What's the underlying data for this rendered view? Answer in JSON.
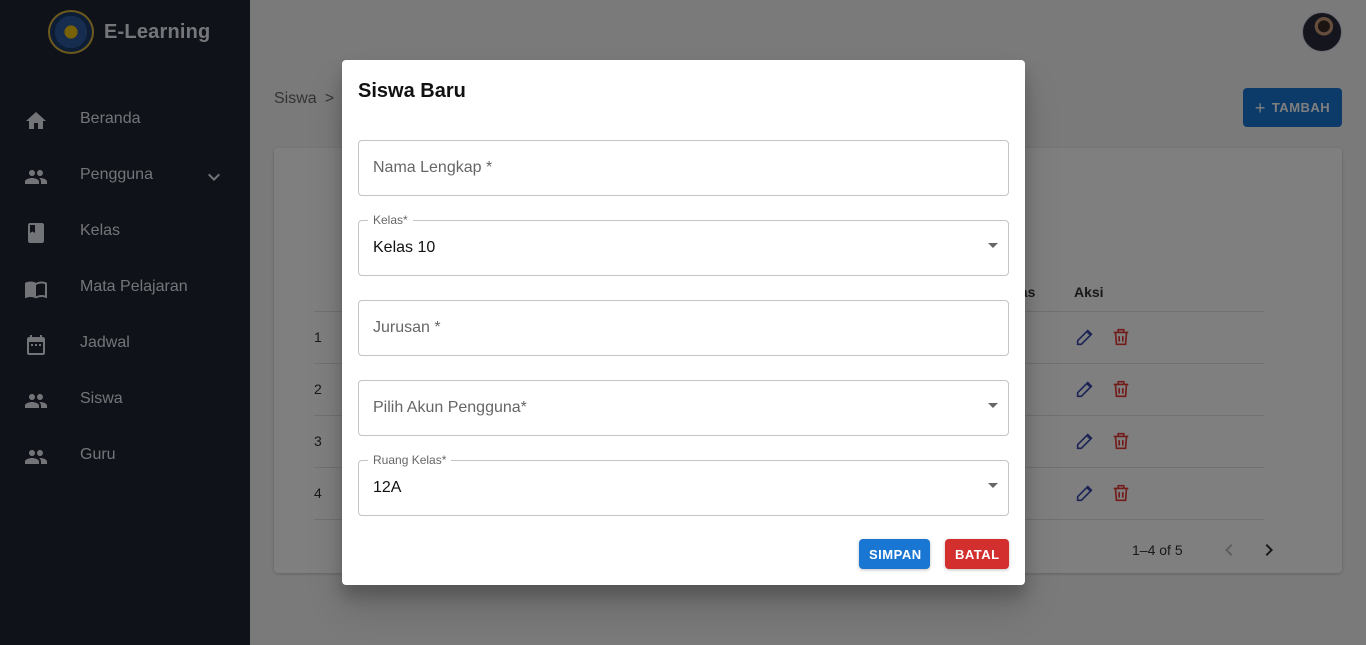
{
  "app": {
    "name": "E-Learning"
  },
  "sidebar": {
    "items": [
      {
        "label": "Beranda",
        "icon": "home-icon"
      },
      {
        "label": "Pengguna",
        "icon": "users-icon",
        "expandable": true
      },
      {
        "label": "Kelas",
        "icon": "book-icon"
      },
      {
        "label": "Mata Pelajaran",
        "icon": "open-book-icon"
      },
      {
        "label": "Jadwal",
        "icon": "calendar-icon"
      },
      {
        "label": "Siswa",
        "icon": "users-icon"
      },
      {
        "label": "Guru",
        "icon": "users-icon"
      }
    ]
  },
  "main": {
    "breadcrumb": [
      "Siswa",
      ">"
    ],
    "add_button": "TAMBAH",
    "table": {
      "headers": [
        "Kelas",
        "Aksi"
      ],
      "rows": [
        {
          "num": "1"
        },
        {
          "num": "2"
        },
        {
          "num": "3"
        },
        {
          "num": "4"
        }
      ],
      "pagination": "1–4 of 5"
    }
  },
  "dialog": {
    "title": "Siswa Baru",
    "fields": {
      "nama_lengkap": {
        "placeholder": "Nama Lengkap *"
      },
      "kelas": {
        "label": "Kelas*",
        "value": "Kelas 10"
      },
      "jurusan": {
        "placeholder": "Jurusan *"
      },
      "akun_pengguna": {
        "placeholder": "Pilih Akun Pengguna*"
      },
      "ruang_kelas": {
        "label": "Ruang Kelas*",
        "value": "12A"
      }
    },
    "buttons": {
      "save": "SIMPAN",
      "cancel": "BATAL"
    }
  },
  "colors": {
    "primary": "#1976d2",
    "danger": "#d32f2f",
    "sidebar": "#1f2433"
  }
}
